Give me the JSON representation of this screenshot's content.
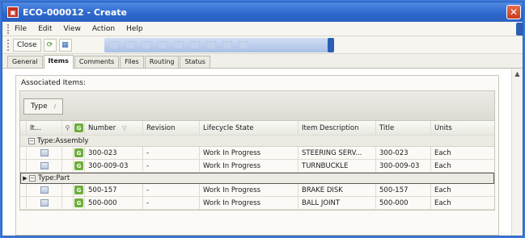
{
  "window": {
    "title": "ECO-000012 - Create"
  },
  "menu": [
    "File",
    "Edit",
    "View",
    "Action",
    "Help"
  ],
  "toolbar": {
    "close_label": "Close"
  },
  "tabs": [
    {
      "label": "General",
      "active": false
    },
    {
      "label": "Items",
      "active": true
    },
    {
      "label": "Comments",
      "active": false
    },
    {
      "label": "Files",
      "active": false
    },
    {
      "label": "Routing",
      "active": false
    },
    {
      "label": "Status",
      "active": false
    }
  ],
  "panel": {
    "title": "Associated Items:",
    "group_by": "Type"
  },
  "grid": {
    "columns": {
      "item": "It...",
      "number": "Number",
      "revision": "Revision",
      "lifecycle": "Lifecycle State",
      "description": "Item Description",
      "title": "Title",
      "units": "Units"
    },
    "groups": [
      {
        "label": "Type:Assembly",
        "rows": [
          {
            "number": "300-023",
            "revision": "-",
            "lifecycle": "Work In Progress",
            "description": "STEERING SERV...",
            "title": "300-023",
            "units": "Each"
          },
          {
            "number": "300-009-03",
            "revision": "-",
            "lifecycle": "Work In Progress",
            "description": "TURNBUCKLE",
            "title": "300-009-03",
            "units": "Each"
          }
        ]
      },
      {
        "label": "Type:Part",
        "rows": [
          {
            "number": "500-157",
            "revision": "-",
            "lifecycle": "Work In Progress",
            "description": "BRAKE DISK",
            "title": "500-157",
            "units": "Each"
          },
          {
            "number": "500-000",
            "revision": "-",
            "lifecycle": "Work In Progress",
            "description": "BALL JOINT",
            "title": "500-000",
            "units": "Each"
          }
        ]
      }
    ]
  }
}
